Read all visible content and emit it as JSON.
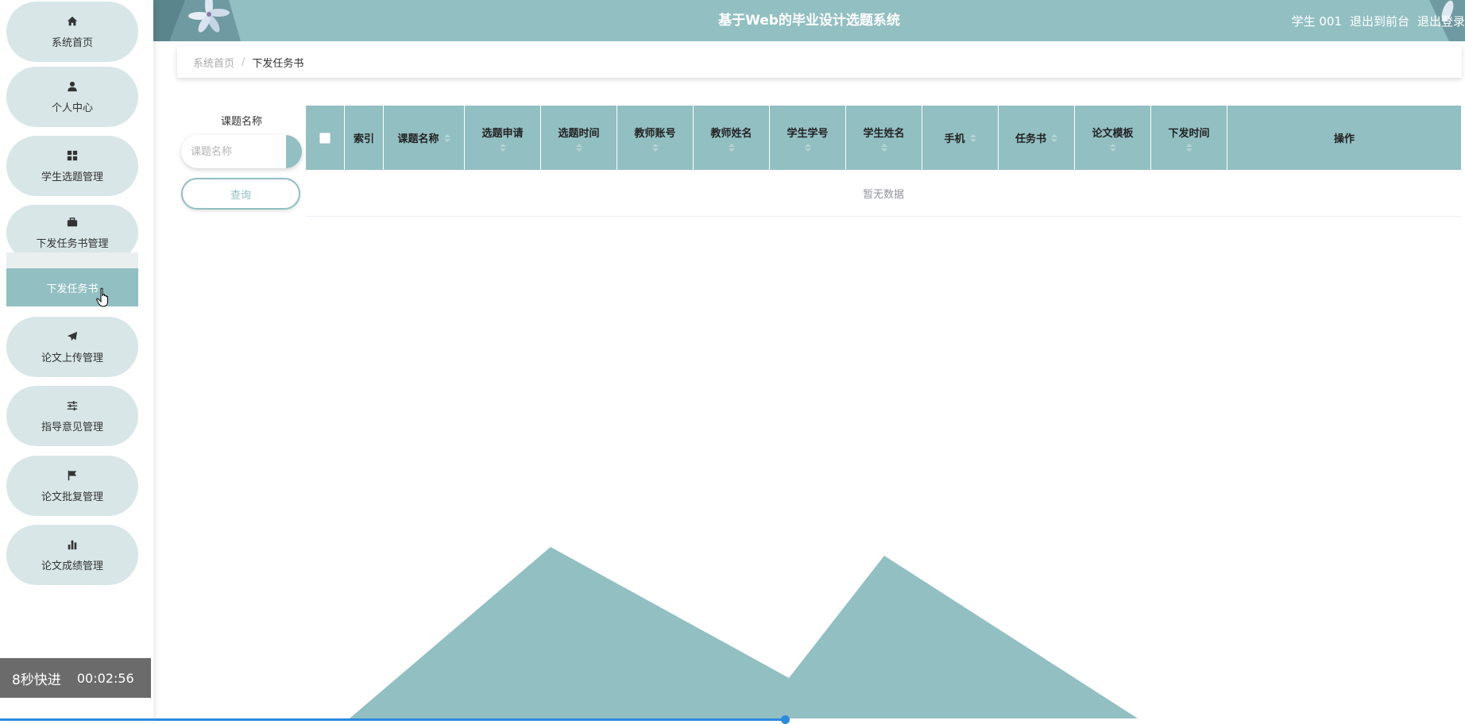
{
  "header": {
    "title": "基于Web的毕业设计选题系统",
    "user": "学生 001",
    "back_front": "退出到前台",
    "logout": "退出登录"
  },
  "sidebar": {
    "items": [
      {
        "label": "系统首页",
        "icon": "home-icon"
      },
      {
        "label": "个人中心",
        "icon": "user-icon"
      },
      {
        "label": "学生选题管理",
        "icon": "grid-icon"
      },
      {
        "label": "下发任务书管理",
        "icon": "briefcase-icon"
      },
      {
        "label": "论文上传管理",
        "icon": "paper-plane-icon"
      },
      {
        "label": "指导意见管理",
        "icon": "sliders-icon"
      },
      {
        "label": "论文批复管理",
        "icon": "flag-icon"
      },
      {
        "label": "论文成绩管理",
        "icon": "bar-chart-icon"
      }
    ],
    "submenu_active": "下发任务书"
  },
  "breadcrumb": {
    "home": "系统首页",
    "separator": "/",
    "current": "下发任务书"
  },
  "search": {
    "label": "课题名称",
    "placeholder": "课题名称",
    "button": "查询"
  },
  "table": {
    "columns": [
      {
        "label": "索引"
      },
      {
        "label": "课题名称"
      },
      {
        "label": "选题申请"
      },
      {
        "label": "选题时间"
      },
      {
        "label": "教师账号"
      },
      {
        "label": "教师姓名"
      },
      {
        "label": "学生学号"
      },
      {
        "label": "学生姓名"
      },
      {
        "label": "手机"
      },
      {
        "label": "任务书"
      },
      {
        "label": "论文模板"
      },
      {
        "label": "下发时间"
      },
      {
        "label": "操作"
      }
    ],
    "empty_text": "暂无数据",
    "rows": []
  },
  "video": {
    "speed_label": "8秒快进",
    "time": "00:02:56",
    "progress": 0.536
  },
  "colors": {
    "primary": "#92bfc2",
    "menu_bg": "#d8e6e7",
    "progress": "#2b8ae0"
  }
}
